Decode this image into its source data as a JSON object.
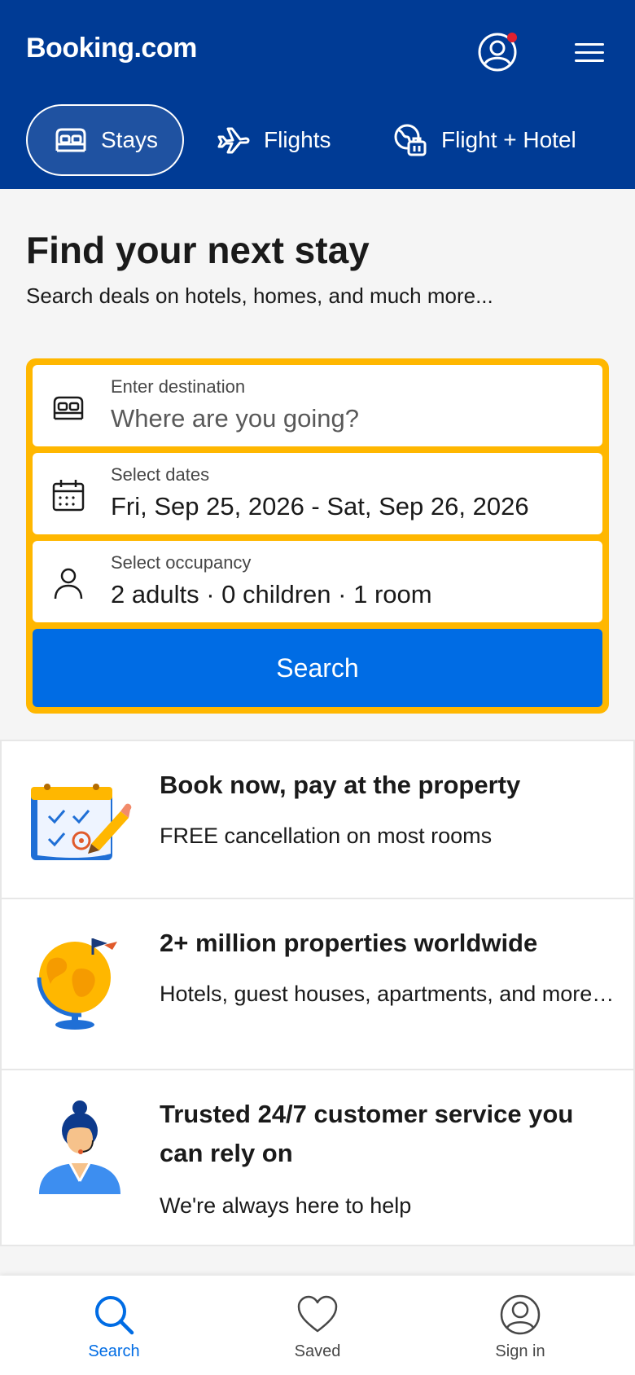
{
  "header": {
    "logo": "Booking.com",
    "tabs": [
      {
        "label": "Stays",
        "icon": "bed-icon",
        "active": true
      },
      {
        "label": "Flights",
        "icon": "plane-icon",
        "active": false
      },
      {
        "label": "Flight + Hotel",
        "icon": "flight-hotel-icon",
        "active": false
      }
    ]
  },
  "hero": {
    "title": "Find your next stay",
    "subtitle": "Search deals on hotels, homes, and much more..."
  },
  "search_form": {
    "destination": {
      "label": "Enter destination",
      "placeholder": "Where are you going?"
    },
    "dates": {
      "label": "Select dates",
      "value": "Fri, Sep 25, 2026 - Sat, Sep 26, 2026"
    },
    "occupancy": {
      "label": "Select occupancy",
      "value": "2 adults · 0 children · 1 room"
    },
    "search_label": "Search"
  },
  "benefits": [
    {
      "title": "Book now, pay at the property",
      "text": "FREE cancellation on most rooms",
      "illustration": "calendar-checklist-illustration"
    },
    {
      "title": "2+ million properties worldwide",
      "text": "Hotels, guest houses, apartments, and more…",
      "illustration": "globe-illustration"
    },
    {
      "title": "Trusted 24/7 customer service you can rely on",
      "text": "We're always here to help",
      "illustration": "support-agent-illustration"
    }
  ],
  "bottom_nav": [
    {
      "label": "Search",
      "icon": "search-icon",
      "active": true
    },
    {
      "label": "Saved",
      "icon": "heart-icon",
      "active": false
    },
    {
      "label": "Sign in",
      "icon": "user-circle-icon",
      "active": false
    }
  ],
  "colors": {
    "brand_blue": "#003b95",
    "accent_yellow": "#ffb700",
    "action_blue": "#006ce4",
    "notification_red": "#e0202f"
  }
}
